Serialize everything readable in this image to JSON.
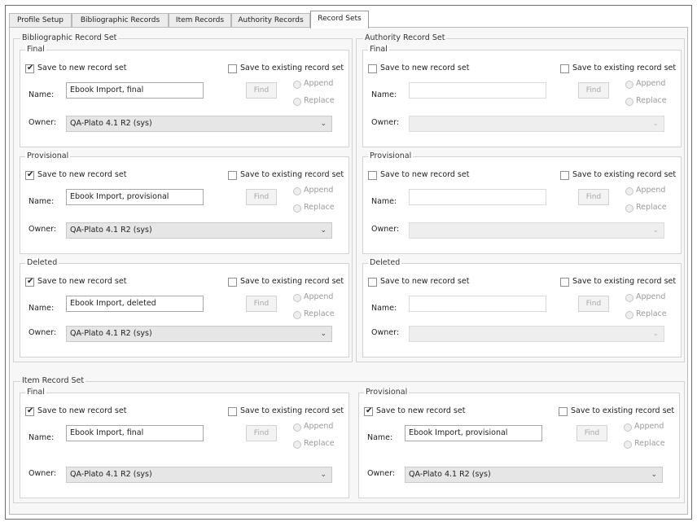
{
  "tabs": [
    {
      "label": "Profile Setup"
    },
    {
      "label": "Bibliographic Records"
    },
    {
      "label": "Item Records"
    },
    {
      "label": "Authority Records"
    },
    {
      "label": "Record Sets",
      "active": true
    }
  ],
  "labels": {
    "save_new": "Save to new record set",
    "save_existing": "Save to existing record set",
    "append": "Append",
    "replace": "Replace",
    "name": "Name:",
    "owner": "Owner:",
    "find": "Find"
  },
  "groups": {
    "bibliographic": {
      "title": "Bibliographic Record Set",
      "sections": [
        {
          "title": "Final",
          "save_new": true,
          "save_existing": false,
          "name": "Ebook Import, final",
          "owner": "QA-Plato 4.1 R2 (sys)"
        },
        {
          "title": "Provisional",
          "save_new": true,
          "save_existing": false,
          "name": "Ebook Import, provisional",
          "owner": "QA-Plato 4.1 R2 (sys)"
        },
        {
          "title": "Deleted",
          "save_new": true,
          "save_existing": false,
          "name": "Ebook Import, deleted",
          "owner": "QA-Plato 4.1 R2 (sys)"
        }
      ]
    },
    "authority": {
      "title": "Authority Record Set",
      "sections": [
        {
          "title": "Final",
          "save_new": false,
          "save_existing": false,
          "name": "",
          "owner": ""
        },
        {
          "title": "Provisional",
          "save_new": false,
          "save_existing": false,
          "name": "",
          "owner": ""
        },
        {
          "title": "Deleted",
          "save_new": false,
          "save_existing": false,
          "name": "",
          "owner": ""
        }
      ]
    },
    "item": {
      "title": "Item Record Set",
      "sections": [
        {
          "title": "Final",
          "save_new": true,
          "save_existing": false,
          "name": "Ebook Import, final",
          "owner": "QA-Plato 4.1 R2 (sys)"
        },
        {
          "title": "Provisional",
          "save_new": true,
          "save_existing": false,
          "name": "Ebook Import, provisional",
          "owner": "QA-Plato 4.1 R2 (sys)"
        }
      ]
    }
  },
  "icons": {
    "check": "check-icon",
    "dropdown": "chevron-down-icon"
  }
}
